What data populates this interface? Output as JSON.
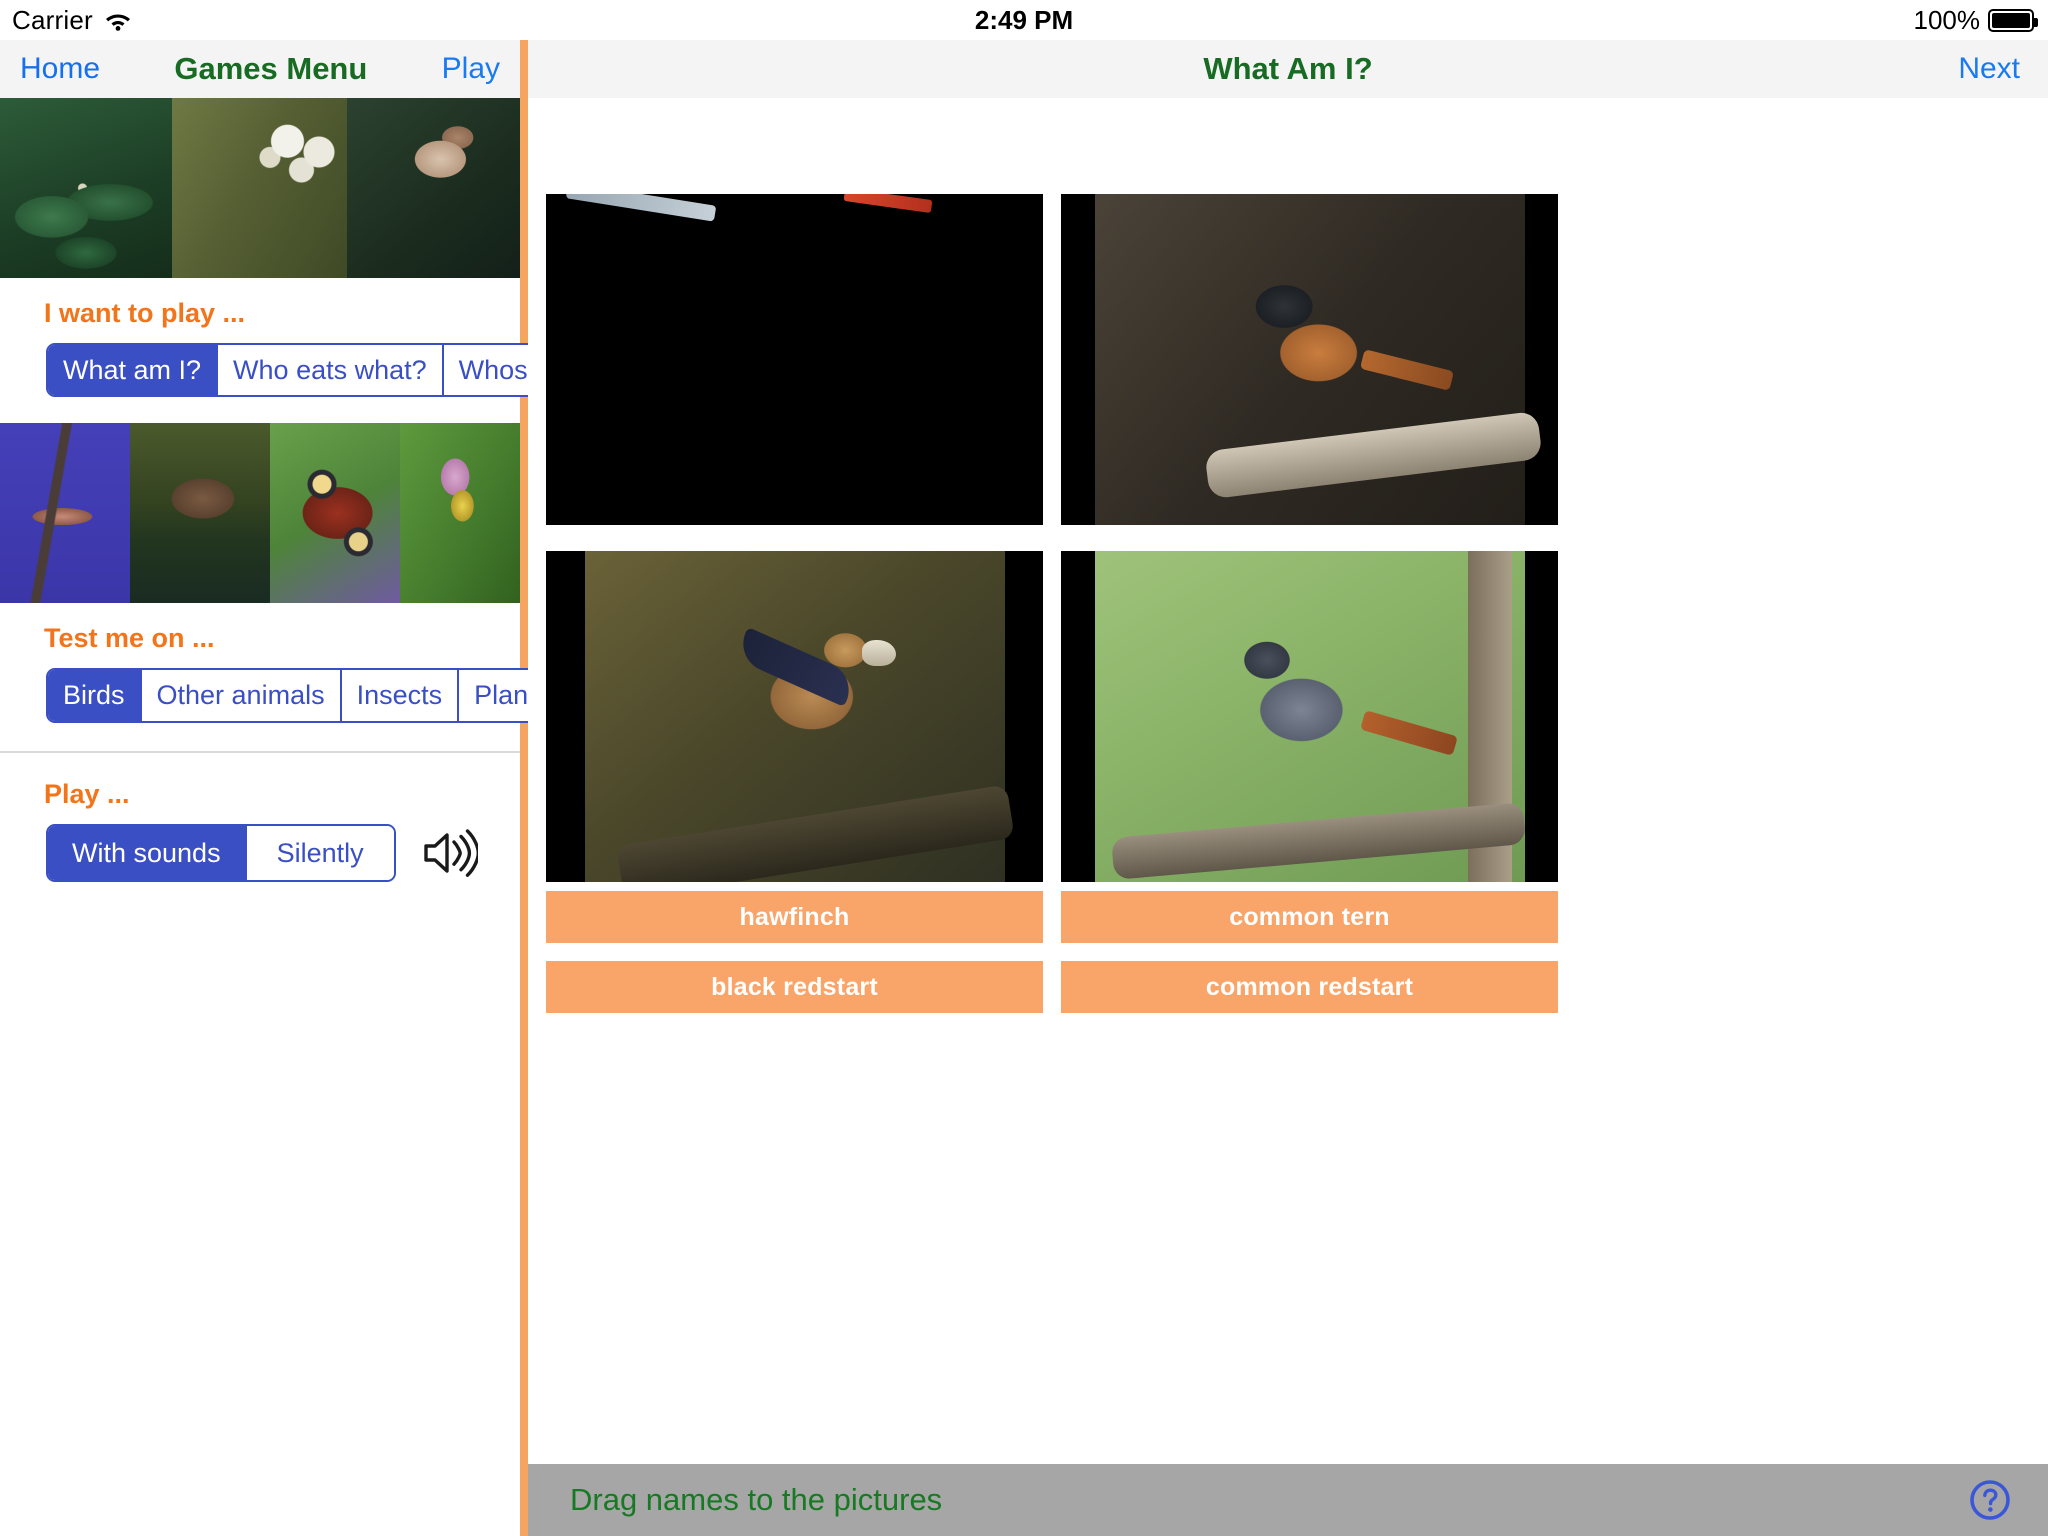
{
  "status_bar": {
    "carrier": "Carrier",
    "wifi_icon": "wifi-icon",
    "time": "2:49 PM",
    "battery_percent": "100%",
    "battery_icon": "battery-full-icon"
  },
  "sidebar": {
    "navbar": {
      "back_label": "Home",
      "title": "Games Menu",
      "action_label": "Play"
    },
    "thumbnails_top": [
      {
        "name": "herb-paris-plant",
        "art": "ph-leaves"
      },
      {
        "name": "white-umbel-flowers",
        "art": "ph-flowers"
      },
      {
        "name": "nightingale-bird",
        "art": "ph-bird-brown"
      }
    ],
    "thumbnails_mid": [
      {
        "name": "red-kite-bird",
        "art": "ph-kite"
      },
      {
        "name": "water-vole-animal",
        "art": "ph-vole"
      },
      {
        "name": "peacock-butterfly",
        "art": "ph-butterfly"
      },
      {
        "name": "bee-orchid-plant",
        "art": "ph-orchid"
      }
    ],
    "sections": [
      {
        "label": "I want to play ...",
        "options": [
          "What am I?",
          "Who eats what?",
          "Whose song?"
        ],
        "selected": "What am I?"
      },
      {
        "label": "Test me on ...",
        "options": [
          "Birds",
          "Other animals",
          "Insects",
          "Plants"
        ],
        "selected": "Birds"
      },
      {
        "label": "Play ...",
        "options": [
          "With sounds",
          "Silently"
        ],
        "selected": "With sounds",
        "trailing_icon": "speaker-sound-icon"
      }
    ]
  },
  "quiz": {
    "navbar": {
      "title": "What Am I?",
      "next_label": "Next"
    },
    "pictures": [
      {
        "name": "quiz-picture-common-tern",
        "art": "tern",
        "letterboxed": false
      },
      {
        "name": "quiz-picture-common-redstart",
        "art": "redstart",
        "letterboxed": true
      },
      {
        "name": "quiz-picture-hawfinch",
        "art": "hawfinch",
        "letterboxed": true
      },
      {
        "name": "quiz-picture-black-redstart",
        "art": "blackredstart",
        "letterboxed": true
      }
    ],
    "answers": [
      "hawfinch",
      "common tern",
      "black redstart",
      "common redstart"
    ],
    "bottom_bar": {
      "instruction": "Drag names to the pictures",
      "help_icon": "help-question-circle-icon"
    }
  },
  "colors": {
    "accent_orange": "#f2741b",
    "answer_orange": "#f9a468",
    "segment_blue": "#3a4fc4",
    "title_green": "#176b22",
    "link_blue": "#1a7af0",
    "divider_orange": "#f5a55f",
    "bottom_bar_grey": "#a6a6a6"
  }
}
